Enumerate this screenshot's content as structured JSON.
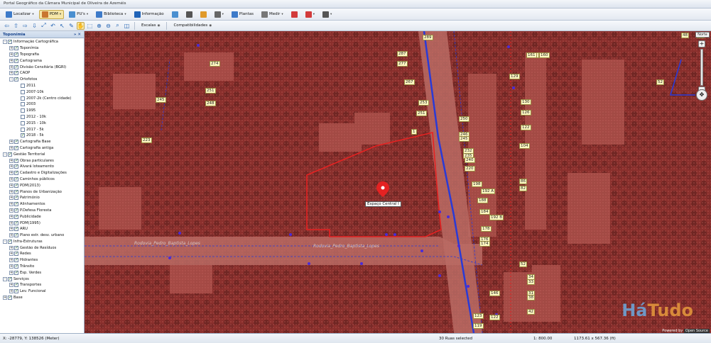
{
  "window_title": "Portal Geográfico da Câmara Municipal de Oliveira de Azeméis",
  "toolbar1": [
    {
      "label": "Localizar",
      "icon": "search-icon",
      "color": "#3d7ac9",
      "caret": true,
      "active": false
    },
    {
      "label": "PDM",
      "icon": "map-icon",
      "color": "#c9772f",
      "caret": true,
      "active": true
    },
    {
      "label": "PU's",
      "icon": "map-icon",
      "color": "#4a8fd0",
      "caret": true,
      "active": false
    },
    {
      "label": "Biblioteca",
      "icon": "books-icon",
      "color": "#3d7ac9",
      "caret": true,
      "active": false
    },
    {
      "label": "Informação",
      "icon": "info-icon",
      "color": "#1f63b8",
      "caret": false,
      "active": false
    },
    {
      "label": "",
      "icon": "globe-icon",
      "color": "#4a8fd0",
      "caret": false,
      "active": false
    },
    {
      "label": "",
      "icon": "print-icon",
      "color": "#555555",
      "caret": false,
      "active": false
    },
    {
      "label": "",
      "icon": "candle-icon",
      "color": "#e09a2a",
      "caret": false,
      "active": false
    },
    {
      "label": "",
      "icon": "gear-icon",
      "color": "#666666",
      "caret": true,
      "active": false
    },
    {
      "label": "Plantas",
      "icon": "plans-icon",
      "color": "#3d7ac9",
      "caret": false,
      "active": false
    },
    {
      "label": "Medir",
      "icon": "ruler-icon",
      "color": "#777777",
      "caret": true,
      "active": false
    },
    {
      "label": "",
      "icon": "chart-icon",
      "color": "#d23b3b",
      "caret": false,
      "active": false
    },
    {
      "label": "",
      "icon": "close-circle-icon",
      "color": "#d23b3b",
      "caret": true,
      "active": false
    },
    {
      "label": "",
      "icon": "tools-icon",
      "color": "#555555",
      "caret": true,
      "active": false
    }
  ],
  "toolbar2": {
    "icons": [
      "arrow-left-icon",
      "arrow-up-icon",
      "arrow-right-icon",
      "arrow-down-icon",
      "zoom-extent-icon",
      "zoom-back-icon",
      "select-arrow-icon",
      "edit-icon",
      "pan-hand-icon",
      "zoom-box-icon",
      "zoom-in-icon",
      "zoom-out-icon",
      "zoom-layer-icon",
      "zoom-fit-icon"
    ],
    "escalas_label": "Escalas",
    "compat_label": "Compatibilidades"
  },
  "sidebar": {
    "title": "Toponímia",
    "tree": [
      {
        "label": "Informação Cartográfica",
        "depth": 0,
        "exp": "-",
        "checked": true
      },
      {
        "label": "Toponímia",
        "depth": 1,
        "exp": "+",
        "checked": true
      },
      {
        "label": "Topografia",
        "depth": 1,
        "exp": "+",
        "checked": true
      },
      {
        "label": "Cartograma",
        "depth": 1,
        "exp": "+",
        "checked": true
      },
      {
        "label": "Divisão Censitária (BGRI)",
        "depth": 1,
        "exp": "+",
        "checked": true
      },
      {
        "label": "CAOP",
        "depth": 1,
        "exp": "+",
        "checked": true
      },
      {
        "label": "Ortofotos",
        "depth": 1,
        "exp": "-",
        "checked": true
      },
      {
        "label": "2011",
        "depth": 2,
        "exp": "",
        "checked": false
      },
      {
        "label": "2007-10k",
        "depth": 2,
        "exp": "",
        "checked": false
      },
      {
        "label": "2007-2k (Centro cidade)",
        "depth": 2,
        "exp": "",
        "checked": false
      },
      {
        "label": "2003",
        "depth": 2,
        "exp": "",
        "checked": false
      },
      {
        "label": "1995",
        "depth": 2,
        "exp": "",
        "checked": false
      },
      {
        "label": "2012 - 10k",
        "depth": 2,
        "exp": "",
        "checked": false
      },
      {
        "label": "2015 - 10k",
        "depth": 2,
        "exp": "",
        "checked": false
      },
      {
        "label": "2017 - 5k",
        "depth": 2,
        "exp": "",
        "checked": false
      },
      {
        "label": "2018 - 5k",
        "depth": 2,
        "exp": "",
        "checked": true
      },
      {
        "label": "Cartografia Base",
        "depth": 1,
        "exp": "+",
        "checked": true
      },
      {
        "label": "Cartografia antiga",
        "depth": 1,
        "exp": "+",
        "checked": true
      },
      {
        "label": "Gestão Territorial",
        "depth": 0,
        "exp": "-",
        "checked": true
      },
      {
        "label": "Obras particulares",
        "depth": 1,
        "exp": "+",
        "checked": true
      },
      {
        "label": "Alvará loteamento",
        "depth": 1,
        "exp": "+",
        "checked": true
      },
      {
        "label": "Cadastro e Digitalizações",
        "depth": 1,
        "exp": "+",
        "checked": true
      },
      {
        "label": "Caminhos públicos",
        "depth": 1,
        "exp": "+",
        "checked": true
      },
      {
        "label": "PDM(2013)",
        "depth": 1,
        "exp": "+",
        "checked": true
      },
      {
        "label": "Planos de Urbanização",
        "depth": 1,
        "exp": "+",
        "checked": true
      },
      {
        "label": "Património",
        "depth": 1,
        "exp": "+",
        "checked": true
      },
      {
        "label": "Alinhamentos",
        "depth": 1,
        "exp": "+",
        "checked": true
      },
      {
        "label": "P.Defesa Floresta",
        "depth": 1,
        "exp": "+",
        "checked": true
      },
      {
        "label": "Publicidade",
        "depth": 1,
        "exp": "+",
        "checked": true
      },
      {
        "label": "PDM(1995)",
        "depth": 1,
        "exp": "+",
        "checked": true
      },
      {
        "label": "ARU",
        "depth": 1,
        "exp": "+",
        "checked": true
      },
      {
        "label": "Plano estr. desv. urbano",
        "depth": 1,
        "exp": "+",
        "checked": true
      },
      {
        "label": "Infra-Estruturas",
        "depth": 0,
        "exp": "-",
        "checked": true
      },
      {
        "label": "Gestão de Resíduos",
        "depth": 1,
        "exp": "+",
        "checked": true
      },
      {
        "label": "Redes",
        "depth": 1,
        "exp": "+",
        "checked": true
      },
      {
        "label": "Hidrantes",
        "depth": 1,
        "exp": "+",
        "checked": true
      },
      {
        "label": "Trânsito",
        "depth": 1,
        "exp": "+",
        "checked": true
      },
      {
        "label": "Esp. Verdes",
        "depth": 1,
        "exp": "+",
        "checked": true
      },
      {
        "label": "Serviços",
        "depth": 0,
        "exp": "-",
        "checked": true
      },
      {
        "label": "Transportes",
        "depth": 1,
        "exp": "+",
        "checked": true
      },
      {
        "label": "Lev. Funcional",
        "depth": 1,
        "exp": "+",
        "checked": true
      },
      {
        "label": "Base",
        "depth": 0,
        "exp": "+",
        "checked": true
      }
    ]
  },
  "map": {
    "place_label": "Espaço Central I",
    "street_label_1": "Rodovia_Pedro_Baptista_Lopes",
    "street_label_2": "Rodovia_Pedro_Baptista_Lopes",
    "house_numbers": [
      "289",
      "287",
      "277",
      "267",
      "274",
      "251",
      "248",
      "245",
      "223",
      "1",
      "253",
      "251",
      "250",
      "246",
      "245",
      "232",
      "235",
      "220",
      "240",
      "198",
      "192 A",
      "188",
      "184",
      "192 B",
      "178",
      "176",
      "174",
      "160",
      "161",
      "160",
      "129",
      "130",
      "126",
      "122",
      "104",
      "86",
      "82",
      "52",
      "48",
      "28",
      "34",
      "33",
      "31",
      "38",
      "42",
      "146",
      "123",
      "119",
      "122",
      "52"
    ],
    "north_label": "Norte",
    "watermark_a": "Há",
    "watermark_b": "Tudo",
    "attribution_text": "Powered by",
    "attribution_brand": "Open Source"
  },
  "status": {
    "coords": "X: -28779, Y: 138526 (Meter)",
    "selection": "30 Ruas selected",
    "scale": "1: 800.00",
    "extent": "1173.61 x 567.36 (ft)"
  },
  "colors": {
    "map_tint": "#8a2f2c",
    "boundary": "#e52222",
    "road_line": "#2a3ad6",
    "point": "#4a2bd8"
  }
}
